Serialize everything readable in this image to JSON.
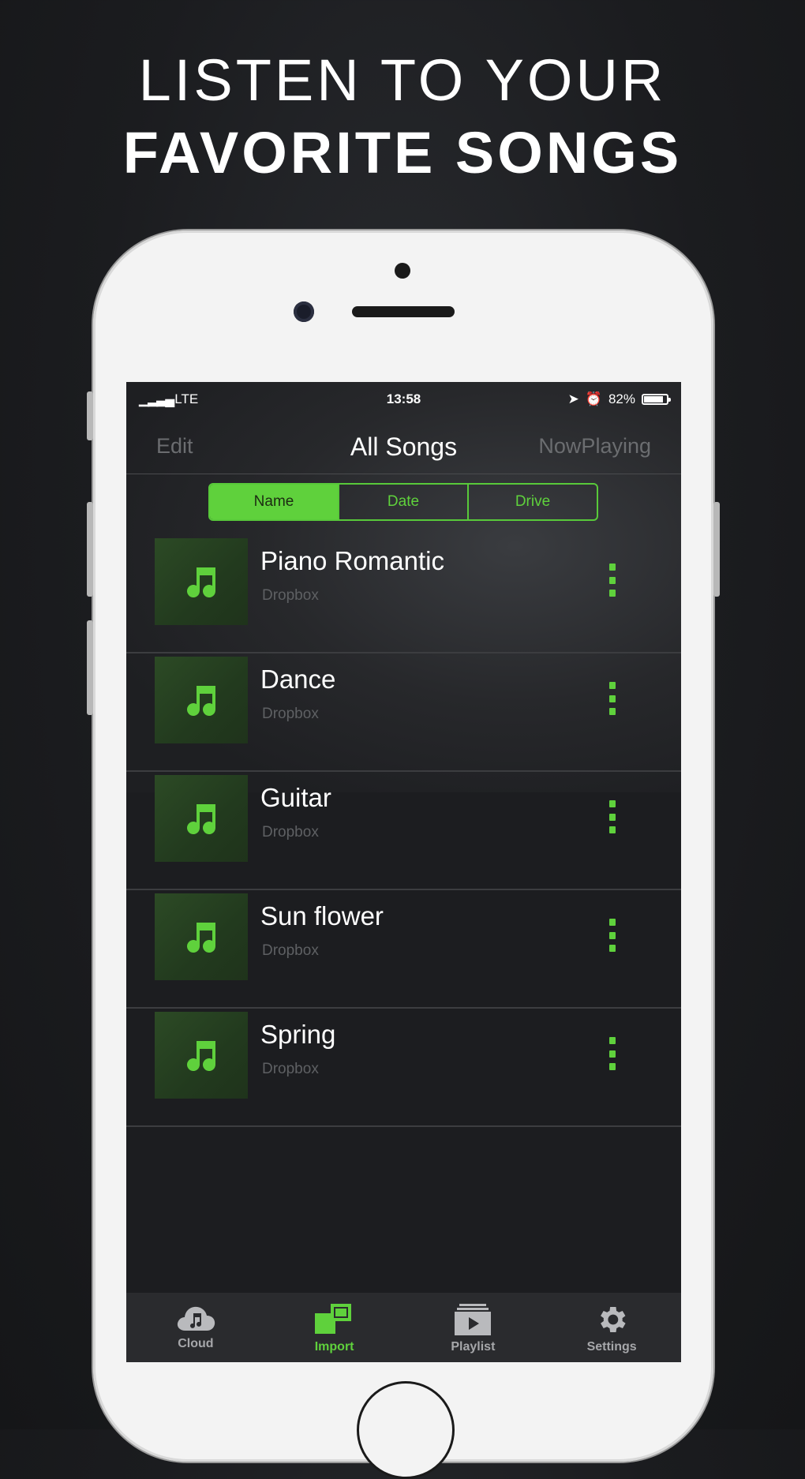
{
  "headline": {
    "line1": "LISTEN TO YOUR",
    "line2": "FAVORITE SONGS"
  },
  "status_bar": {
    "carrier": "LTE",
    "time": "13:58",
    "battery": "82%"
  },
  "nav": {
    "left": "Edit",
    "title": "All Songs",
    "right": "NowPlaying"
  },
  "segments": [
    {
      "label": "Name",
      "active": true
    },
    {
      "label": "Date",
      "active": false
    },
    {
      "label": "Drive",
      "active": false
    }
  ],
  "songs": [
    {
      "title": "Piano Romantic",
      "source": "Dropbox"
    },
    {
      "title": "Dance",
      "source": "Dropbox"
    },
    {
      "title": "Guitar",
      "source": "Dropbox"
    },
    {
      "title": "Sun flower",
      "source": "Dropbox"
    },
    {
      "title": "Spring",
      "source": "Dropbox"
    }
  ],
  "tabs": [
    {
      "label": "Cloud",
      "icon": "cloud-music-icon",
      "active": false
    },
    {
      "label": "Import",
      "icon": "import-icon",
      "active": true
    },
    {
      "label": "Playlist",
      "icon": "playlist-icon",
      "active": false
    },
    {
      "label": "Settings",
      "icon": "gear-icon",
      "active": false
    }
  ],
  "colors": {
    "accent": "#5fd13c",
    "background": "#1c1d20",
    "tab_inactive": "#a6a7aa"
  }
}
